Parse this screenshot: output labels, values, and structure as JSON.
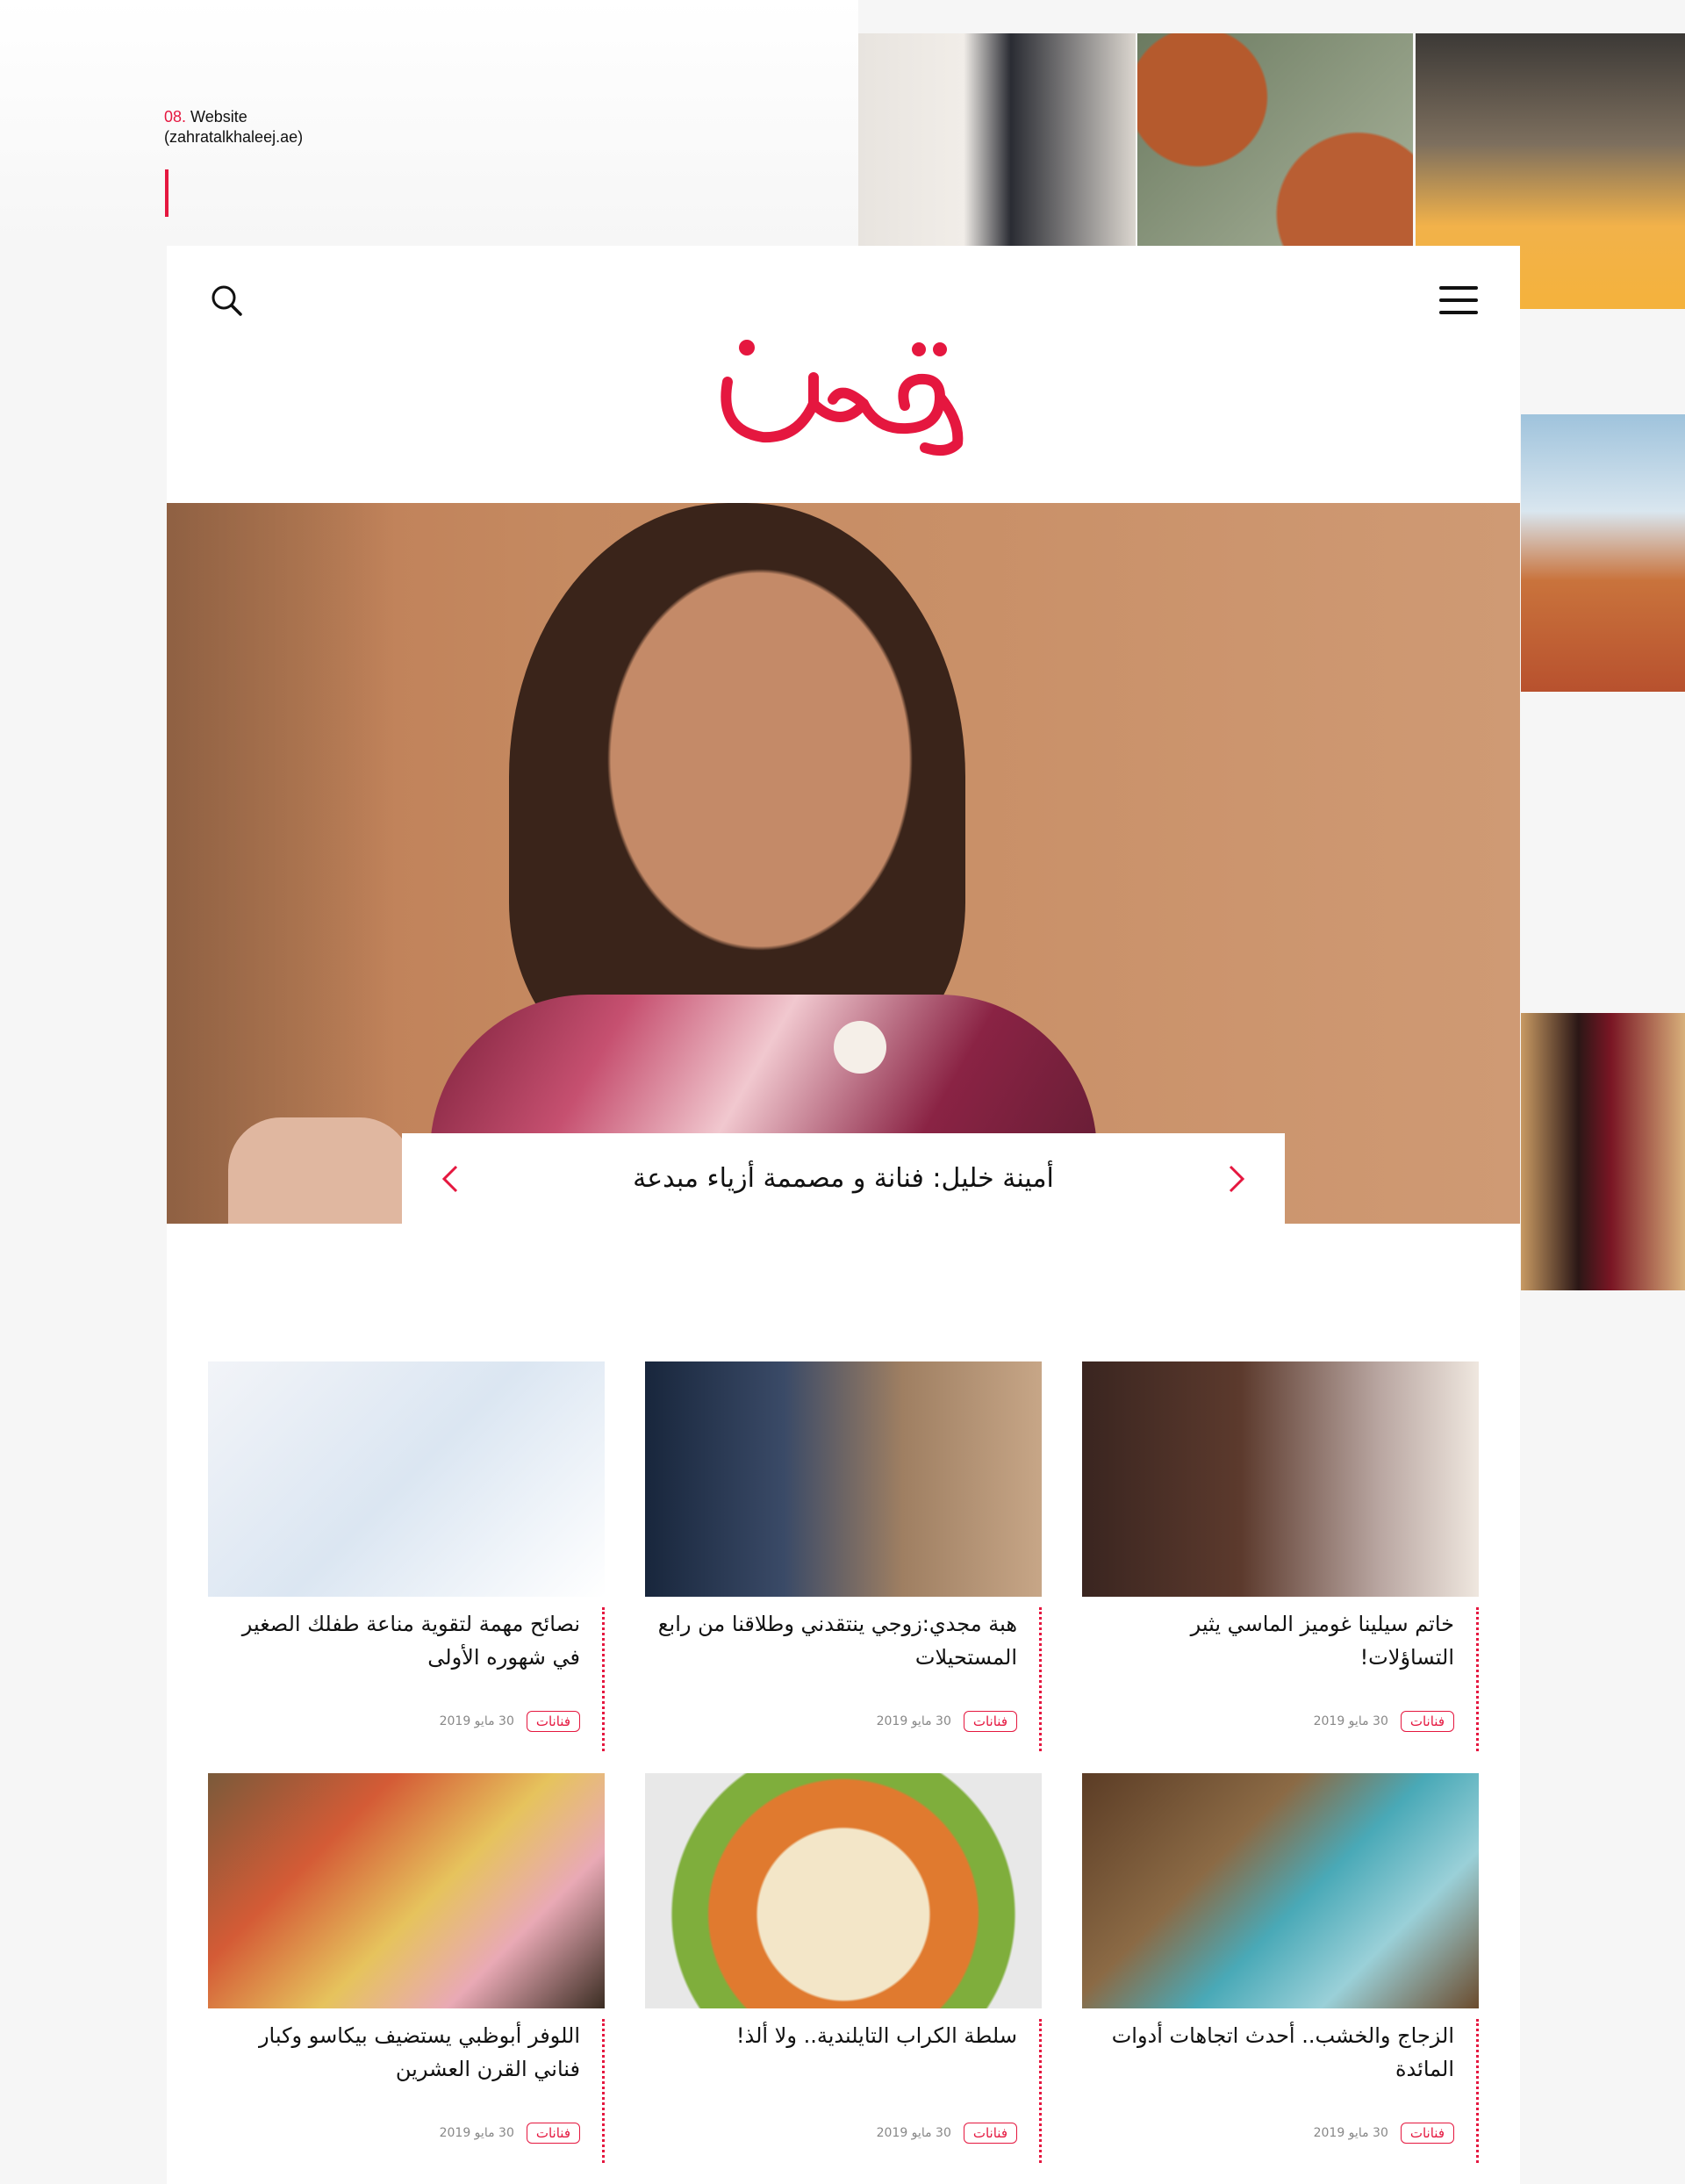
{
  "caption": {
    "number": "08.",
    "label": "Website",
    "domain": "(zahratalkhaleej.ae)"
  },
  "colors": {
    "brand": "#e5173f",
    "text": "#111111",
    "background": "#f6f6f6"
  },
  "site": {
    "logo_text": "زهرة",
    "icons": {
      "search": "search-icon",
      "menu": "hamburger-icon",
      "prev": "chevron-left-icon",
      "next": "chevron-right-icon"
    },
    "hero": {
      "title": "أمينة خليل: فنانة و مصممة أزياء مبدعة"
    },
    "articles": [
      {
        "title": "خاتم سيلينا غوميز الماسي يثير التساؤلات!",
        "category": "فنانات",
        "date": "30 مايو 2019"
      },
      {
        "title": "هبة مجدي:زوجي ينتقدني وطلاقنا من رابع المستحيلات",
        "category": "فنانات",
        "date": "30 مايو 2019"
      },
      {
        "title": "نصائح مهمة لتقوية مناعة طفلك الصغير في شهوره الأولى",
        "category": "فنانات",
        "date": "30 مايو 2019"
      },
      {
        "title": "الزجاج والخشب.. أحدث اتجاهات أدوات المائدة",
        "category": "فنانات",
        "date": "30 مايو 2019"
      },
      {
        "title": "سلطة الكراب التايلندية.. ولا ألذ!",
        "category": "فنانات",
        "date": "30 مايو 2019"
      },
      {
        "title": "اللوفر أبوظبي يستضيف بيكاسو وكبار فناني القرن العشرين",
        "category": "فنانات",
        "date": "30 مايو 2019"
      }
    ]
  }
}
